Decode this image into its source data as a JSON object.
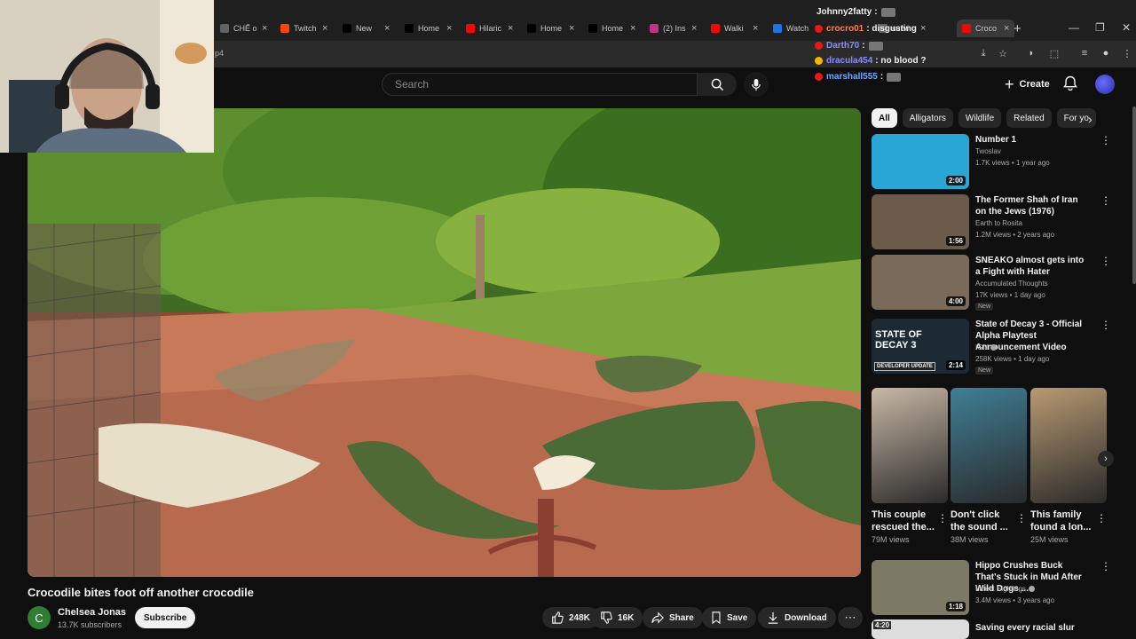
{
  "browser": {
    "tabs": [
      {
        "label": "CHẾ o",
        "icon": "web-icon",
        "color": "#5f6368"
      },
      {
        "label": "Twitch",
        "icon": "reddit-icon",
        "color": "#ff4500"
      },
      {
        "label": "New",
        "icon": "x-icon",
        "color": "#000000"
      },
      {
        "label": "Home",
        "icon": "x-icon",
        "color": "#000000"
      },
      {
        "label": "Hilaric",
        "icon": "youtube-icon",
        "color": "#ff0000"
      },
      {
        "label": "Home",
        "icon": "x-icon",
        "color": "#000000"
      },
      {
        "label": "Home",
        "icon": "x-icon",
        "color": "#000000"
      },
      {
        "label": "(2) Ins",
        "icon": "instagram-icon",
        "color": "#c13584"
      },
      {
        "label": "Walki",
        "icon": "youtube-icon",
        "color": "#ff0000"
      },
      {
        "label": "Watch",
        "icon": "web-icon",
        "color": "#1a73e8"
      },
      {
        "label": "survi",
        "icon": "web-icon",
        "color": "#5f6368"
      },
      {
        "label": "Croco",
        "icon": "youtube-icon",
        "color": "#ff0000"
      }
    ],
    "url_fragment": "p4"
  },
  "chat": [
    {
      "user": "Johnny2fatty",
      "message": ":",
      "color": "#f1f1f1",
      "badge": ""
    },
    {
      "user": "crocro01",
      "message": ": disgusting",
      "color": "#ff7f50",
      "badge": "#e91916"
    },
    {
      "user": "Darth70",
      "message": ":",
      "color": "#8a8cff",
      "badge": "#e91916"
    },
    {
      "user": "dracula454",
      "message": ": no blood ?",
      "color": "#8a8cff",
      "badge": "#f7b500"
    },
    {
      "user": "marshall555",
      "message": ":",
      "color": "#6ea8ff",
      "badge": "#e91916"
    }
  ],
  "header": {
    "search_placeholder": "Search",
    "create_label": "Create"
  },
  "video": {
    "title": "Crocodile bites foot off another crocodile",
    "channel": "Chelsea Jonas",
    "channel_initial": "C",
    "subscribers": "13.7K subscribers",
    "subscribe_label": "Subscribe",
    "likes": "248K",
    "dislikes": "16K",
    "share_label": "Share",
    "save_label": "Save",
    "download_label": "Download"
  },
  "chips": [
    "All",
    "Alligators",
    "Wildlife",
    "Related",
    "For yo"
  ],
  "recommendations": [
    {
      "title": "Number 1",
      "channel": "Twoslav",
      "meta": "1.7K views • 1 year ago",
      "duration": "2:00",
      "is_new": false,
      "verified": false,
      "thumb_color": "#2aa6d6"
    },
    {
      "title": "The Former Shah of Iran on the Jews (1976)",
      "channel": "Earth to Rosita",
      "meta": "1.2M views • 2 years ago",
      "duration": "1:56",
      "is_new": false,
      "verified": false,
      "thumb_color": "#6b5a4a"
    },
    {
      "title": "SNEAKO almost gets into a Fight with Hater",
      "channel": "Accumulated Thoughts",
      "meta": "17K views • 1 day ago",
      "duration": "4:00",
      "is_new": true,
      "new_label": "New",
      "verified": false,
      "thumb_color": "#7a6a5a"
    },
    {
      "title": "State of Decay 3 - Official Alpha Playtest Announcement Video",
      "channel": "IGN",
      "meta": "258K views • 1 day ago",
      "duration": "2:14",
      "is_new": true,
      "new_label": "New",
      "verified": true,
      "thumb_color": "#1d2a33",
      "thumb_text": "STATE OF DECAY 3",
      "thumb_badge": "DEVELOPER UPDATE"
    }
  ],
  "shorts": [
    {
      "title": "This couple rescued the...",
      "views": "79M views",
      "thumb_color": "#c9b8a6"
    },
    {
      "title": "Don't click the sound ...",
      "views": "38M views",
      "thumb_color": "#3f7f96"
    },
    {
      "title": "This family found a lon...",
      "views": "25M views",
      "thumb_color": "#b89a72"
    }
  ],
  "recommendation_last": {
    "title": "Hippo Crushes Buck That's Stuck in Mud After Wild Dogs ...",
    "channel": "Latest Sightings",
    "meta": "3.4M views • 3 years ago",
    "duration": "1:18",
    "verified": true,
    "thumb_color": "#7c7a64"
  },
  "recommendation_cutoff": {
    "title": "Saving every racial slur",
    "duration": "4:20"
  }
}
